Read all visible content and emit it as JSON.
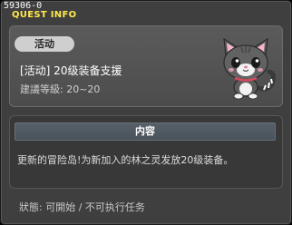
{
  "window": {
    "id_label": "59306-0",
    "title": "QUEST INFO"
  },
  "quest": {
    "category_tag": "活动",
    "name": "[活动] 20级装备支援",
    "recommended_level": "建議等級: 20~20",
    "npc_icon": "gray-cat-icon"
  },
  "content": {
    "header": "内容",
    "text": "更新的冒险岛!为新加入的林之灵发放20级装备。"
  },
  "status": {
    "text": "狀態: 可開始 / 不可执行任务"
  },
  "colors": {
    "title": "#ffe94b",
    "panel": "#4f4f4f",
    "content_header": "#505a63"
  }
}
